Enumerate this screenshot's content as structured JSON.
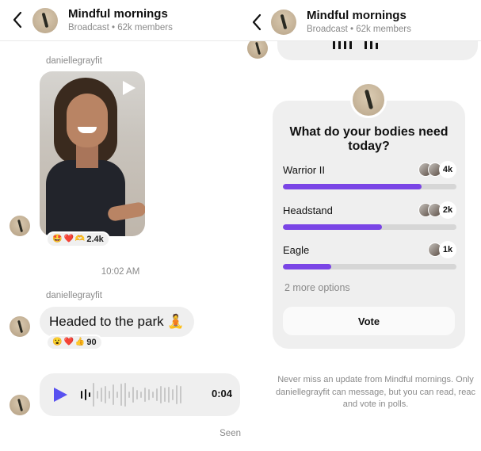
{
  "channel": {
    "title": "Mindful mornings",
    "subtitle": "Broadcast • 62k members"
  },
  "left": {
    "video_message": {
      "sender": "daniellegrayfit",
      "reactions": {
        "emojis": [
          "🤩",
          "❤️",
          "🫶"
        ],
        "count": "2.4k"
      }
    },
    "timestamp": "10:02 AM",
    "text_message": {
      "sender": "daniellegrayfit",
      "text": "Headed to the park 🧘",
      "reactions": {
        "emojis": [
          "😮",
          "❤️",
          "👍"
        ],
        "count": "90"
      }
    },
    "voice_message": {
      "duration": "0:04",
      "progress": 0.1
    },
    "seen_label": "Seen"
  },
  "right": {
    "poll": {
      "question": "What do your bodies need today?",
      "options": [
        {
          "label": "Warrior II",
          "votes": "4k",
          "share": 0.8
        },
        {
          "label": "Headstand",
          "votes": "2k",
          "share": 0.57
        },
        {
          "label": "Eagle",
          "votes": "1k",
          "share": 0.28
        }
      ],
      "more_options": "2 more options",
      "vote_label": "Vote"
    },
    "footer_lines": [
      "Never miss an update from Mindful mornings. Only",
      "daniellegrayfit can message, but you can read, reac",
      "and vote in polls."
    ]
  },
  "colors": {
    "accent_purple": "#7a45e6",
    "play_blue": "#5851f0"
  }
}
